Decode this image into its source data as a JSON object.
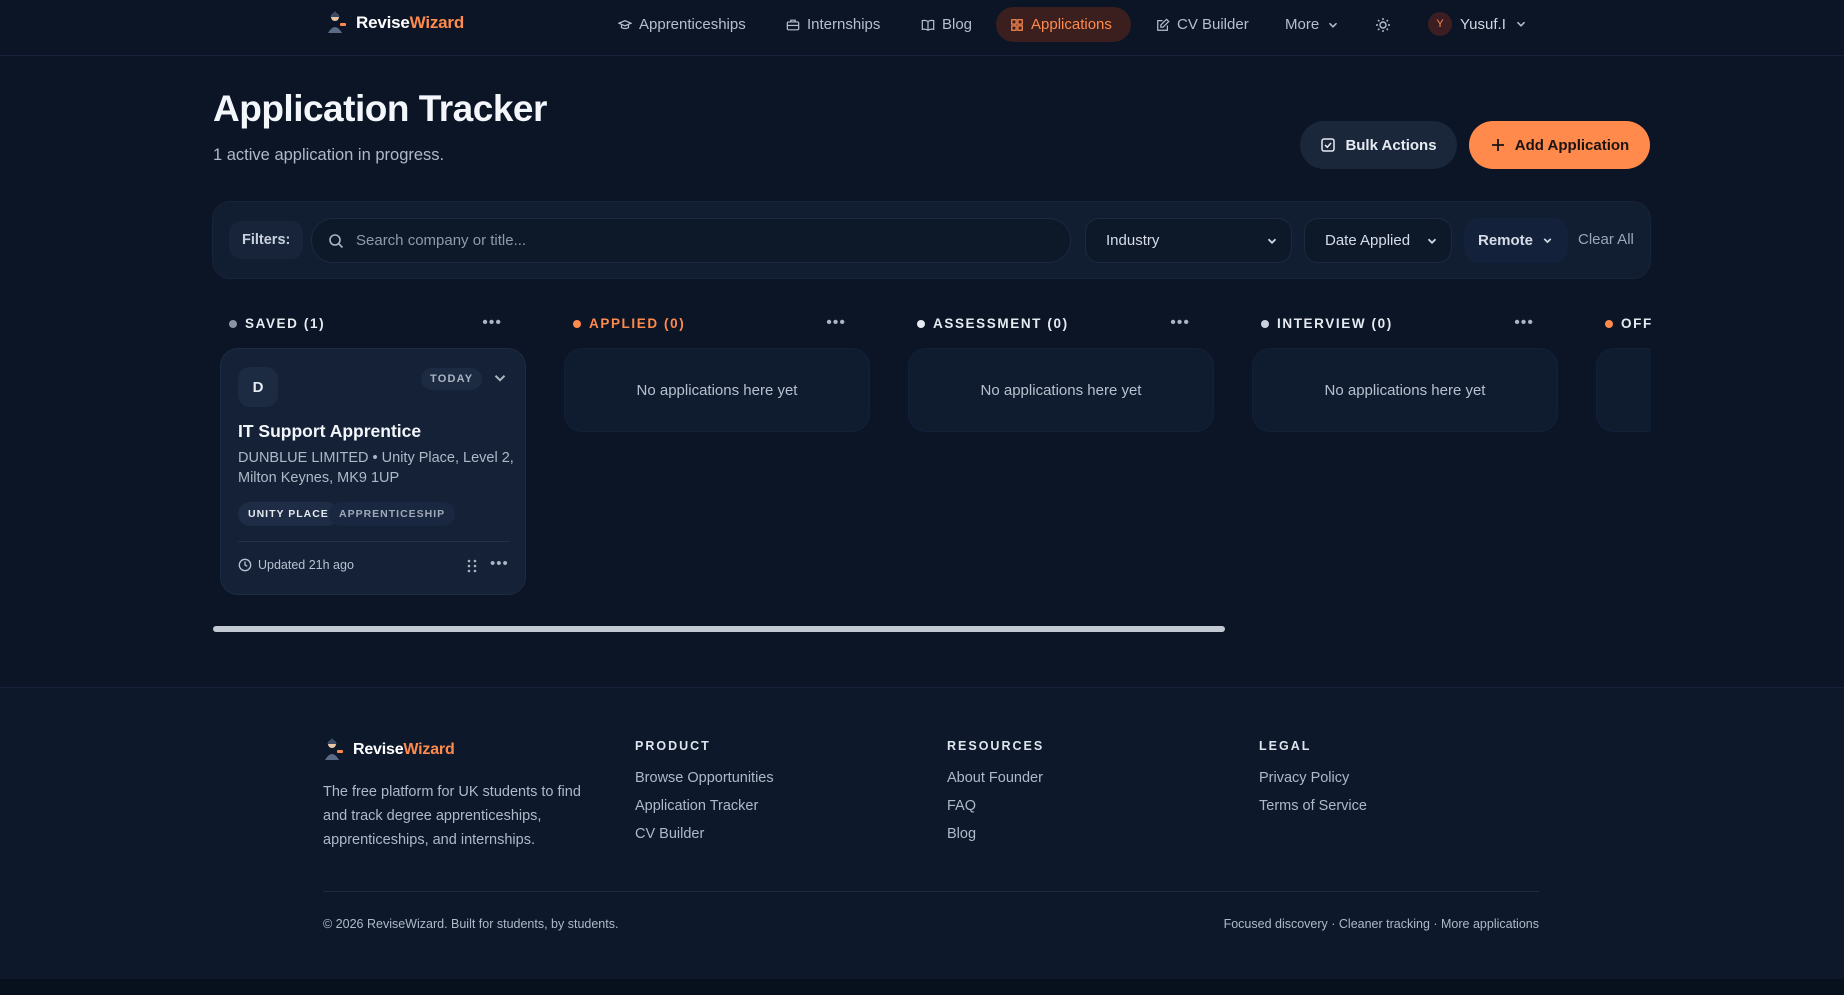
{
  "brand": {
    "name_part1": "Revise",
    "name_part2": "Wizard"
  },
  "nav": {
    "links": [
      {
        "label": "Apprenticeships",
        "icon": "graduation-cap-icon"
      },
      {
        "label": "Internships",
        "icon": "briefcase-icon"
      },
      {
        "label": "Blog",
        "icon": "book-open-icon"
      },
      {
        "label": "Applications",
        "icon": "grid-icon",
        "active": true
      },
      {
        "label": "CV Builder",
        "icon": "pencil-square-icon"
      },
      {
        "label": "More",
        "icon": "chevron-down-icon"
      }
    ],
    "theme_icon": "sun-icon",
    "user": {
      "initial": "Y",
      "name": "Yusuf.I"
    }
  },
  "header": {
    "title": "Application Tracker",
    "subtitle": "1 active application in progress.",
    "bulk_label": "Bulk Actions",
    "add_label": "Add Application"
  },
  "filters": {
    "label": "Filters:",
    "search_placeholder": "Search company or title...",
    "industry": "Industry",
    "date_applied": "Date Applied",
    "remote": "Remote",
    "clear": "Clear All"
  },
  "board": {
    "columns": [
      {
        "title": "SAVED (1)",
        "color": "#8a93a3"
      },
      {
        "title": "APPLIED (0)",
        "color": "#ff8a4c",
        "empty": "No applications here yet"
      },
      {
        "title": "ASSESSMENT (0)",
        "color": "#e6ebf2",
        "empty": "No applications here yet"
      },
      {
        "title": "INTERVIEW (0)",
        "color": "#c9d2de",
        "empty": "No applications here yet"
      },
      {
        "title": "OFF",
        "color": "#ff8a4c"
      }
    ],
    "card": {
      "initial": "D",
      "date_badge": "TODAY",
      "title": "IT Support Apprentice",
      "description": "DUNBLUE LIMITED • Unity Place, Level 2, Milton Keynes, MK9 1UP",
      "tags": [
        "UNITY PLACE",
        "APPRENTICESHIP"
      ],
      "updated": "Updated 21h ago"
    }
  },
  "footer": {
    "description": "The free platform for UK students to find and track degree apprenticeships, apprenticeships, and internships.",
    "product": {
      "heading": "PRODUCT",
      "links": [
        "Browse Opportunities",
        "Application Tracker",
        "CV Builder"
      ]
    },
    "resources": {
      "heading": "RESOURCES",
      "links": [
        "About Founder",
        "FAQ",
        "Blog"
      ]
    },
    "legal": {
      "heading": "LEGAL",
      "links": [
        "Privacy Policy",
        "Terms of Service"
      ]
    },
    "copyright": "© 2026 ReviseWizard. Built for students, by students.",
    "taglines": "Focused discovery · Cleaner tracking · More applications"
  },
  "colors": {
    "accent": "#ff8a4c",
    "background": "#0b1526"
  }
}
